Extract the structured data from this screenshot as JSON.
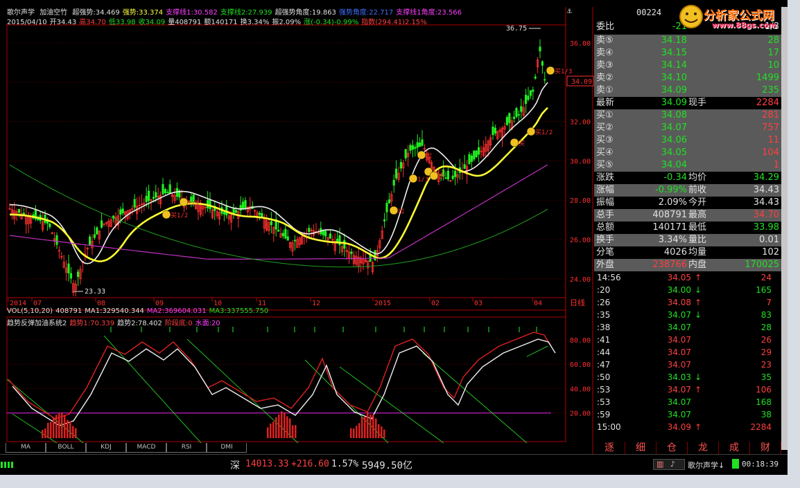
{
  "header": {
    "stock_name": "歌尔声学",
    "indicator": "加油空竹",
    "items": [
      {
        "label": "超强势:34.469",
        "color": "wh"
      },
      {
        "label": "强势:33.374",
        "color": "yl"
      },
      {
        "label": "支撑线1:30.582",
        "color": "mg"
      },
      {
        "label": "支撑线2:27.939",
        "color": "dn"
      },
      {
        "label": "超强势角度:19.863",
        "color": "wh"
      },
      {
        "label": "强势角度:22.717",
        "color": "bl"
      },
      {
        "label": "支撑线1角度:23.566",
        "color": "mg"
      }
    ],
    "stock_code": "00224",
    "watermark": "分析家公式网",
    "watermark_url": "www.88gs.com"
  },
  "info2": [
    {
      "label": "2015/04/10",
      "color": "wh"
    },
    {
      "label": "开34.43",
      "color": "wh"
    },
    {
      "label": "高34.70",
      "color": "up"
    },
    {
      "label": "低33.98",
      "color": "dn"
    },
    {
      "label": "收34.09",
      "color": "dn"
    },
    {
      "label": "量408791",
      "color": "wh"
    },
    {
      "label": "额140171",
      "color": "wh"
    },
    {
      "label": "换3.34%",
      "color": "wh"
    },
    {
      "label": "振2.09%",
      "color": "wh"
    },
    {
      "label": "涨(-0.34)-0.99%",
      "color": "dn"
    },
    {
      "label": "指数(294.41)2.15%",
      "color": "up"
    }
  ],
  "price_axis": [
    "36.00",
    "34.00",
    "32.00",
    "30.00",
    "28.00",
    "26.00",
    "24.00"
  ],
  "price_high_label": "36.75",
  "price_low_label": "23.33",
  "current_price_label": "34.09",
  "signals": [
    "买1/2",
    "1/4",
    "出",
    "1/2",
    "1/3",
    "出",
    "买",
    "买1/2",
    "买1/3",
    "出"
  ],
  "date_axis": [
    "2014",
    "07",
    "08",
    "09",
    "10",
    "11",
    "12",
    "2015",
    "02",
    "03",
    "04"
  ],
  "period_label": "日线",
  "volume": {
    "items": [
      {
        "label": "VOL(5,10,20)",
        "color": "wh"
      },
      {
        "label": "408791",
        "color": "wh"
      },
      {
        "label": "MA1:329540.344",
        "color": "wh"
      },
      {
        "label": "MA2:369604.031",
        "color": "mg"
      },
      {
        "label": "MA3:337555.750",
        "color": "dn"
      }
    ]
  },
  "oscillator": {
    "items": [
      {
        "label": "趋势反弹加油系统2",
        "color": "wh"
      },
      {
        "label": "趋势1:70.339",
        "color": "up"
      },
      {
        "label": "趋势2:78.402",
        "color": "wh"
      },
      {
        "label": "阶段底:0",
        "color": "up"
      },
      {
        "label": "水面:20",
        "color": "mg"
      }
    ],
    "axis": [
      "80.00",
      "60.00",
      "40.00",
      "20.00"
    ]
  },
  "bottom_tabs": [
    "MA",
    "BOLL",
    "KDJ",
    "MACD",
    "RSI",
    "DMI"
  ],
  "quote": {
    "committee": {
      "label": "委比",
      "v1": "-21",
      "v2": "1/3"
    },
    "asks": [
      {
        "label": "卖⑤",
        "price": "34.18",
        "vol": "28"
      },
      {
        "label": "卖④",
        "price": "34.15",
        "vol": "17"
      },
      {
        "label": "卖③",
        "price": "34.14",
        "vol": "10"
      },
      {
        "label": "卖②",
        "price": "34.10",
        "vol": "1499"
      },
      {
        "label": "卖①",
        "price": "34.09",
        "vol": "235"
      }
    ],
    "latest": {
      "label": "最新",
      "price": "34.09",
      "label2": "现手",
      "vol": "2284"
    },
    "bids": [
      {
        "label": "买①",
        "price": "34.08",
        "vol": "281"
      },
      {
        "label": "买②",
        "price": "34.07",
        "vol": "757"
      },
      {
        "label": "买③",
        "price": "34.06",
        "vol": "11"
      },
      {
        "label": "买④",
        "price": "34.05",
        "vol": "104"
      },
      {
        "label": "买⑤",
        "price": "34.04",
        "vol": "1"
      }
    ],
    "stats": [
      {
        "l1": "涨跌",
        "v1": "-0.34",
        "c1": "dn",
        "l2": "均价",
        "v2": "34.29",
        "c2": "dn"
      },
      {
        "l1": "涨幅",
        "v1": "-0.99%",
        "c1": "dn",
        "l2": "前收",
        "v2": "34.43",
        "c2": "wh"
      },
      {
        "l1": "振幅",
        "v1": "2.09%",
        "c1": "wh",
        "l2": "今开",
        "v2": "34.43",
        "c2": "wh"
      },
      {
        "l1": "总手",
        "v1": "408791",
        "c1": "wh",
        "l2": "最高",
        "v2": "34.70",
        "c2": "up"
      },
      {
        "l1": "总额",
        "v1": "140171",
        "c1": "wh",
        "l2": "最低",
        "v2": "33.98",
        "c2": "dn"
      },
      {
        "l1": "换手",
        "v1": "3.34%",
        "c1": "wh",
        "l2": "量比",
        "v2": "0.01",
        "c2": "wh"
      },
      {
        "l1": "分笔",
        "v1": "4026",
        "c1": "wh",
        "l2": "均量",
        "v2": "102",
        "c2": "wh"
      },
      {
        "l1": "外盘",
        "v1": "238766",
        "c1": "up",
        "l2": "内盘",
        "v2": "170025",
        "c2": "dn"
      }
    ]
  },
  "ticks": [
    {
      "t": "14:56",
      "p": "34.05",
      "a": "↑",
      "v": "24",
      "c": "up"
    },
    {
      "t": ":20",
      "p": "34.00",
      "a": "↓",
      "v": "165",
      "c": "dn"
    },
    {
      "t": ":26",
      "p": "34.08",
      "a": "↑",
      "v": "7",
      "c": "up"
    },
    {
      "t": ":35",
      "p": "34.07",
      "a": "↓",
      "v": "83",
      "c": "dn"
    },
    {
      "t": ":38",
      "p": "34.07",
      "a": "",
      "v": "28",
      "c": "dn"
    },
    {
      "t": ":41",
      "p": "34.07",
      "a": "",
      "v": "26",
      "c": "up"
    },
    {
      "t": ":44",
      "p": "34.07",
      "a": "",
      "v": "29",
      "c": "up"
    },
    {
      "t": ":47",
      "p": "34.07",
      "a": "",
      "v": "23",
      "c": "up"
    },
    {
      "t": ":50",
      "p": "34.03",
      "a": "↓",
      "v": "35",
      "c": "dn"
    },
    {
      "t": ":53",
      "p": "34.07",
      "a": "↑",
      "v": "106",
      "c": "up"
    },
    {
      "t": ":53",
      "p": "34.07",
      "a": "",
      "v": "168",
      "c": "dn"
    },
    {
      "t": ":59",
      "p": "34.07",
      "a": "",
      "v": "38",
      "c": "dn"
    },
    {
      "t": "15:00",
      "p": "34.09",
      "a": "↑",
      "v": "2284",
      "c": "up"
    }
  ],
  "right_tabs": [
    "逐",
    "细",
    "仓",
    "龙",
    "成",
    "财"
  ],
  "status": {
    "market": "深",
    "index": "14013.33",
    "change": "+216.60",
    "pct": "1.57%",
    "amount": "5949.50亿",
    "ticker": "歌尔声学↓",
    "clock": "00:18:39"
  }
}
